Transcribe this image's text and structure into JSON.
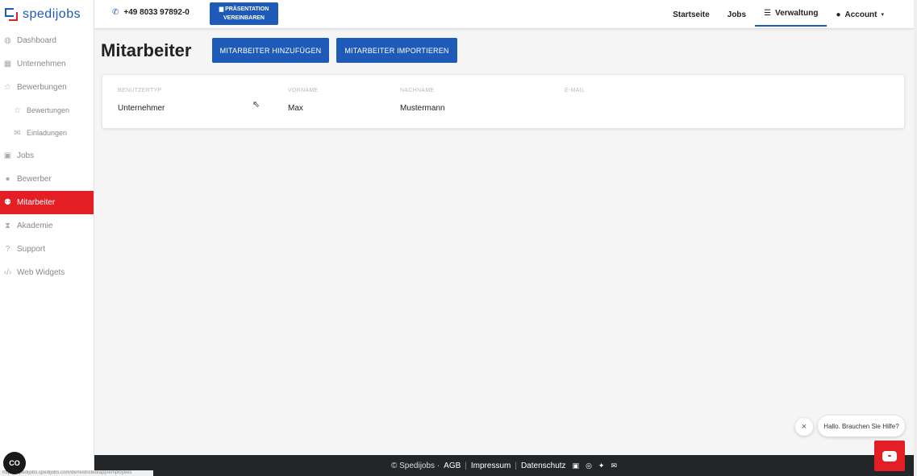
{
  "app": {
    "logo_text_a": "spedi",
    "logo_text_b": "jobs"
  },
  "sidebar": {
    "items": [
      {
        "label": "Dashboard",
        "icon": "palette-icon"
      },
      {
        "label": "Unternehmen",
        "icon": "building-icon"
      },
      {
        "label": "Bewerbungen",
        "icon": "star-icon"
      },
      {
        "label": "Bewertungen",
        "icon": "star-icon"
      },
      {
        "label": "Einladungen",
        "icon": "envelope-icon"
      },
      {
        "label": "Jobs",
        "icon": "briefcase-icon"
      },
      {
        "label": "Bewerber",
        "icon": "user-icon"
      },
      {
        "label": "Mitarbeiter",
        "icon": "users-icon"
      },
      {
        "label": "Akademie",
        "icon": "hourglass-icon"
      },
      {
        "label": "Support",
        "icon": "question-icon"
      },
      {
        "label": "Web Widgets",
        "icon": "code-icon"
      }
    ]
  },
  "topbar": {
    "phone": "+49 8033 97892-0",
    "presentation_line1": "PRÄSENTATION",
    "presentation_line2": "VEREINBAREN",
    "nav": {
      "startseite": "Startseite",
      "jobs": "Jobs",
      "verwaltung": "Verwaltung",
      "account": "Account"
    }
  },
  "main": {
    "title": "Mitarbeiter",
    "add_button": "MITARBEITER HINZUFÜGEN",
    "import_button": "MITARBEITER IMPORTIEREN",
    "table": {
      "headers": [
        "BENUTZERTYP",
        "VORNAME",
        "NACHNAME",
        "E-MAIL"
      ],
      "rows": [
        [
          "Unternehmer",
          "Max",
          "Mustermann",
          ""
        ]
      ]
    }
  },
  "footer": {
    "copyright": "© Spedijobs ·",
    "agb": "AGB",
    "impressum": "Impressum",
    "datenschutz": "Datenschutz",
    "sep": "|",
    "status_url": "https://spedijobs.spedijobs.com/de/restricted/app/employees"
  },
  "cookie": {
    "label": "CO"
  },
  "chat": {
    "bubble": "Hallo. Brauchen Sie Hilfe?",
    "close": "×"
  },
  "colors": {
    "brand_blue": "#1e5bb8",
    "brand_red": "#e31e24",
    "footer_bg": "#222629"
  }
}
